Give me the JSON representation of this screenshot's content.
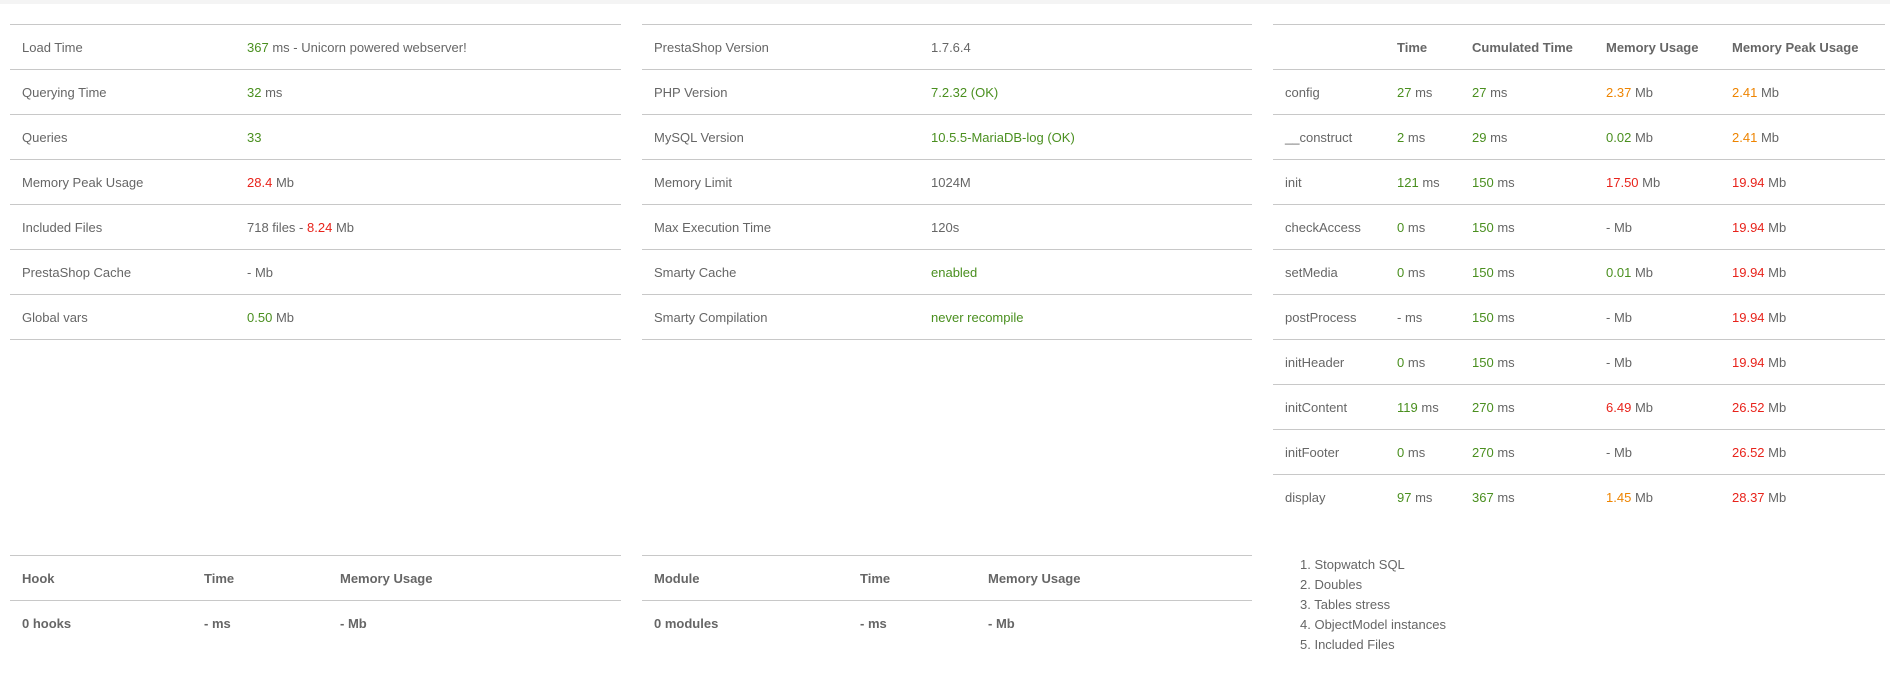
{
  "summary": {
    "load_time": {
      "label": "Load Time",
      "value": "367",
      "unit": "ms",
      "suffix": "- Unicorn powered webserver!"
    },
    "querying_time": {
      "label": "Querying Time",
      "value": "32",
      "unit": "ms"
    },
    "queries": {
      "label": "Queries",
      "value": "33"
    },
    "memory_peak": {
      "label": "Memory Peak Usage",
      "value": "28.4",
      "unit": "Mb"
    },
    "included_files": {
      "label": "Included Files",
      "files": "718 files",
      "sep": "-",
      "size": "8.24",
      "unit": "Mb"
    },
    "prestashop_cache": {
      "label": "PrestaShop Cache",
      "value": "-",
      "unit": "Mb"
    },
    "global_vars": {
      "label": "Global vars",
      "value": "0.50",
      "unit": "Mb"
    }
  },
  "config": {
    "prestashop_version": {
      "label": "PrestaShop Version",
      "value": "1.7.6.4"
    },
    "php_version": {
      "label": "PHP Version",
      "value": "7.2.32 (OK)"
    },
    "mysql_version": {
      "label": "MySQL Version",
      "value": "10.5.5-MariaDB-log (OK)"
    },
    "memory_limit": {
      "label": "Memory Limit",
      "value": "1024M"
    },
    "max_execution": {
      "label": "Max Execution Time",
      "value": "120s"
    },
    "smarty_cache": {
      "label": "Smarty Cache",
      "value": "enabled"
    },
    "smarty_compilation": {
      "label": "Smarty Compilation",
      "value": "never recompile"
    }
  },
  "stopwatch": {
    "headers": [
      "",
      "Time",
      "Cumulated Time",
      "Memory Usage",
      "Memory Peak Usage"
    ],
    "rows": [
      {
        "name": "config",
        "time": "27",
        "cum": "27",
        "mem": "2.37",
        "peak": "2.41"
      },
      {
        "name": "__construct",
        "time": "2",
        "cum": "29",
        "mem": "0.02",
        "peak": "2.41"
      },
      {
        "name": "init",
        "time": "121",
        "cum": "150",
        "mem": "17.50",
        "peak": "19.94"
      },
      {
        "name": "checkAccess",
        "time": "0",
        "cum": "150",
        "mem": "-",
        "peak": "19.94"
      },
      {
        "name": "setMedia",
        "time": "0",
        "cum": "150",
        "mem": "0.01",
        "peak": "19.94"
      },
      {
        "name": "postProcess",
        "time": "-",
        "cum": "150",
        "mem": "-",
        "peak": "19.94"
      },
      {
        "name": "initHeader",
        "time": "0",
        "cum": "150",
        "mem": "-",
        "peak": "19.94"
      },
      {
        "name": "initContent",
        "time": "119",
        "cum": "270",
        "mem": "6.49",
        "peak": "26.52"
      },
      {
        "name": "initFooter",
        "time": "0",
        "cum": "270",
        "mem": "-",
        "peak": "26.52"
      },
      {
        "name": "display",
        "time": "97",
        "cum": "367",
        "mem": "1.45",
        "peak": "28.37"
      }
    ],
    "units": {
      "time": "ms",
      "mem": "Mb"
    }
  },
  "hooks": {
    "headers": [
      "Hook",
      "Time",
      "Memory Usage"
    ],
    "row": [
      "0 hooks",
      "- ms",
      "- Mb"
    ]
  },
  "modules": {
    "headers": [
      "Module",
      "Time",
      "Memory Usage"
    ],
    "row": [
      "0 modules",
      "- ms",
      "- Mb"
    ]
  },
  "links": [
    "1. Stopwatch SQL",
    "2. Doubles",
    "3. Tables stress",
    "4. ObjectModel instances",
    "5. Included Files"
  ],
  "colors": {
    "good": "#4a8f1f",
    "warn": "#ee8400",
    "bad": "#e8231b",
    "text": "#666666",
    "border": "#c8c8c8"
  }
}
